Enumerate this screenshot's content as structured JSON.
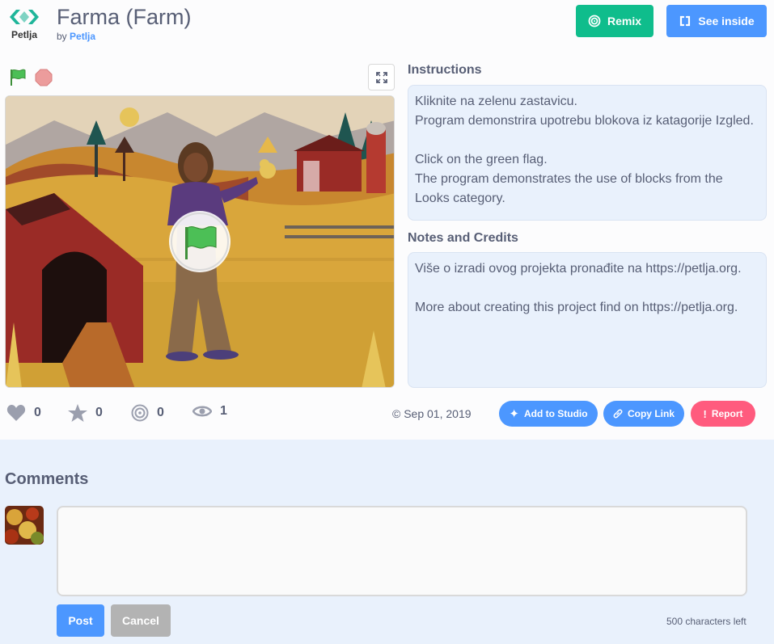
{
  "header": {
    "logo_text": "Petlja",
    "title": "Farma (Farm)",
    "by_prefix": "by",
    "author": "Petlja",
    "remix_label": "Remix",
    "see_inside_label": "See inside"
  },
  "instructions": {
    "label": "Instructions",
    "text": "Kliknite na zelenu zastavicu.\nProgram demonstrira upotrebu blokova iz katagorije Izgled.\n\nClick on the green flag.\nThe program demonstrates the use of blocks from the Looks category."
  },
  "notes": {
    "label": "Notes and Credits",
    "text": "Više o izradi ovog projekta pronađite na https://petlja.org.\n\nMore about creating this project find on https://petlja.org."
  },
  "stats": {
    "loves": "0",
    "favorites": "0",
    "remixes": "0",
    "views": "1",
    "date": "Sep 01, 2019"
  },
  "actions": {
    "add_to_studio": "Add to Studio",
    "copy_link": "Copy Link",
    "report": "Report"
  },
  "comments": {
    "title": "Comments",
    "post_label": "Post",
    "cancel_label": "Cancel",
    "chars_left": "500 characters left"
  },
  "colors": {
    "brand_green": "#0fbd8c",
    "brand_blue": "#4c97ff",
    "report_pink": "#ff5b7e",
    "text": "#575e75"
  }
}
